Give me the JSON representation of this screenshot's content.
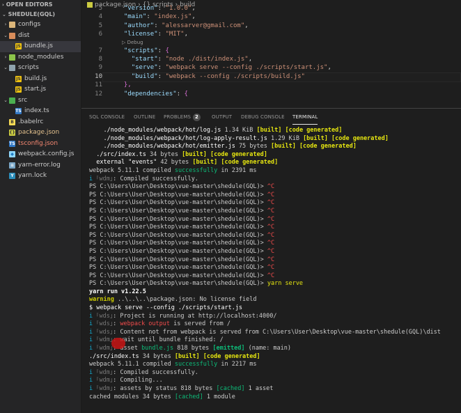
{
  "sidebar": {
    "open_editors": "OPEN EDITORS",
    "project": "SHEDULE(GQL)",
    "items": [
      {
        "label": "configs",
        "kind": "folder",
        "chev": "›",
        "icon": "folder",
        "depth": 0,
        "color": "#cccccc"
      },
      {
        "label": "dist",
        "kind": "folder",
        "chev": "⌄",
        "icon": "folder dist",
        "depth": 0,
        "color": "#cccccc"
      },
      {
        "label": "bundle.js",
        "kind": "file",
        "icon": "js",
        "glyph": "JS",
        "depth": 1,
        "color": "#cccccc",
        "active": true
      },
      {
        "label": "node_modules",
        "kind": "folder",
        "chev": "›",
        "icon": "folder node",
        "depth": 0,
        "color": "#cccccc"
      },
      {
        "label": "scripts",
        "kind": "folder",
        "chev": "⌄",
        "icon": "folder scripts",
        "depth": 0,
        "color": "#cccccc"
      },
      {
        "label": "build.js",
        "kind": "file",
        "icon": "js",
        "glyph": "JS",
        "depth": 1,
        "color": "#cccccc"
      },
      {
        "label": "start.js",
        "kind": "file",
        "icon": "js",
        "glyph": "JS",
        "depth": 1,
        "color": "#cccccc"
      },
      {
        "label": "src",
        "kind": "folder",
        "chev": "⌄",
        "icon": "folder src",
        "depth": 0,
        "color": "#cccccc"
      },
      {
        "label": "index.ts",
        "kind": "file",
        "icon": "ts",
        "glyph": "TS",
        "depth": 1,
        "color": "#cccccc"
      },
      {
        "label": ".babelrc",
        "kind": "file",
        "icon": "babel",
        "glyph": "B",
        "depth": 0,
        "color": "#cccccc"
      },
      {
        "label": "package.json",
        "kind": "file",
        "icon": "json",
        "glyph": "{}",
        "depth": 0,
        "color": "#e2c08d"
      },
      {
        "label": "tsconfig.json",
        "kind": "file",
        "icon": "ts",
        "glyph": "TS",
        "depth": 0,
        "color": "#f48771"
      },
      {
        "label": "webpack.config.js",
        "kind": "file",
        "icon": "wp",
        "glyph": "◆",
        "depth": 0,
        "color": "#cccccc"
      },
      {
        "label": "yarn-error.log",
        "kind": "file",
        "icon": "log",
        "glyph": "≡",
        "depth": 0,
        "color": "#cccccc"
      },
      {
        "label": "yarn.lock",
        "kind": "file",
        "icon": "lock",
        "glyph": "Y",
        "depth": 0,
        "color": "#cccccc"
      }
    ]
  },
  "breadcrumb": {
    "file": "package.json",
    "sep1": "›",
    "obj": "{} scripts",
    "sep2": "›",
    "leaf": "build"
  },
  "editor": {
    "lines": [
      {
        "n": "5",
        "segs": [
          [
            "  ",
            "pun"
          ],
          [
            "\"version\"",
            "key"
          ],
          [
            ": ",
            "pun"
          ],
          [
            "\"1.0.0\"",
            "str"
          ],
          [
            ",",
            "pun"
          ]
        ]
      },
      {
        "n": "4",
        "segs": [
          [
            "  ",
            "pun"
          ],
          [
            "\"main\"",
            "key"
          ],
          [
            ": ",
            "pun"
          ],
          [
            "\"index.js\"",
            "str"
          ],
          [
            ",",
            "pun"
          ]
        ]
      },
      {
        "n": "5",
        "segs": [
          [
            "  ",
            "pun"
          ],
          [
            "\"author\"",
            "key"
          ],
          [
            ": ",
            "pun"
          ],
          [
            "\"alessarver@gmail.com\"",
            "str"
          ],
          [
            ",",
            "pun"
          ]
        ]
      },
      {
        "n": "6",
        "segs": [
          [
            "  ",
            "pun"
          ],
          [
            "\"license\"",
            "key"
          ],
          [
            ": ",
            "pun"
          ],
          [
            "\"MIT\"",
            "str"
          ],
          [
            ",",
            "pun"
          ]
        ]
      },
      {
        "n": "7",
        "segs": [
          [
            "  ",
            "pun"
          ],
          [
            "\"scripts\"",
            "key"
          ],
          [
            ": ",
            "pun"
          ],
          [
            "{",
            "brk"
          ]
        ]
      },
      {
        "n": "8",
        "segs": [
          [
            "    ",
            "pun"
          ],
          [
            "\"start\"",
            "key"
          ],
          [
            ": ",
            "pun"
          ],
          [
            "\"node ./dist/index.js\"",
            "str"
          ],
          [
            ",",
            "pun"
          ]
        ]
      },
      {
        "n": "9",
        "segs": [
          [
            "    ",
            "pun"
          ],
          [
            "\"serve\"",
            "key"
          ],
          [
            ": ",
            "pun"
          ],
          [
            "\"webpack serve --config ./scripts/start.js\"",
            "str"
          ],
          [
            ",",
            "pun"
          ]
        ]
      },
      {
        "n": "10",
        "cur": true,
        "segs": [
          [
            "    ",
            "pun"
          ],
          [
            "\"build\"",
            "key"
          ],
          [
            ": ",
            "pun"
          ],
          [
            "\"webpack --config ./scripts/build.js\"",
            "str"
          ]
        ]
      },
      {
        "n": "11",
        "segs": [
          [
            "  ",
            "pun"
          ],
          [
            "},",
            "brk"
          ]
        ]
      },
      {
        "n": "12",
        "segs": [
          [
            "  ",
            "pun"
          ],
          [
            "\"dependencies\"",
            "key"
          ],
          [
            ": ",
            "pun"
          ],
          [
            "{",
            "brk"
          ]
        ]
      }
    ],
    "debug_hint": "▷ Debug"
  },
  "panel": {
    "tabs": [
      {
        "label": "SQL CONSOLE"
      },
      {
        "label": "OUTPUT",
        "pre": "OUTLINE"
      },
      {
        "label": "PROBLEMS",
        "badge": "2"
      },
      {
        "label": "OUTPUT"
      },
      {
        "label": "DEBUG CONSOLE"
      },
      {
        "label": "TERMINAL",
        "active": true
      }
    ],
    "tab_labels": [
      "SQL CONSOLE",
      "OUTLINE",
      "PROBLEMS",
      "OUTPUT",
      "DEBUG CONSOLE",
      "TERMINAL"
    ],
    "problems_count": "2"
  },
  "terminal": {
    "lines": [
      [
        [
          "    ./node_modules/webpack/hot/log.js ",
          "w"
        ],
        [
          "1.34 KiB ",
          "pl"
        ],
        [
          "[built] [code generated]",
          "y b"
        ]
      ],
      [
        [
          "    ./node_modules/webpack/hot/log-apply-result.js ",
          "w"
        ],
        [
          "1.29 KiB ",
          "pl"
        ],
        [
          "[built] [code generated]",
          "y b"
        ]
      ],
      [
        [
          "    ./node_modules/webpack/hot/emitter.js ",
          "w"
        ],
        [
          "75 bytes ",
          "pl"
        ],
        [
          "[built] [code generated]",
          "y b"
        ]
      ],
      [
        [
          "  ./src/index.ts ",
          "w"
        ],
        [
          "34 bytes ",
          "pl"
        ],
        [
          "[built] [code generated]",
          "y b"
        ]
      ],
      [
        [
          "  external \"events\" ",
          "w"
        ],
        [
          "42 bytes ",
          "pl"
        ],
        [
          "[built] [code generated]",
          "y b"
        ]
      ],
      [
        [
          "webpack 5.11.1 compiled ",
          "pl"
        ],
        [
          "successfully",
          "g"
        ],
        [
          " in 2391 ms",
          "pl"
        ]
      ],
      [
        [
          "i ",
          "c"
        ],
        [
          "｢wdm｣",
          "gr"
        ],
        [
          ": Compiled successfully.",
          "pl"
        ]
      ],
      [
        [
          "PS C:\\Users\\User\\Desktop\\vue-master\\shedule(GQL)> ",
          "pl"
        ],
        [
          "^C",
          "r"
        ]
      ],
      [
        [
          "PS C:\\Users\\User\\Desktop\\vue-master\\shedule(GQL)> ",
          "pl"
        ],
        [
          "^C",
          "r"
        ]
      ],
      [
        [
          "PS C:\\Users\\User\\Desktop\\vue-master\\shedule(GQL)> ",
          "pl"
        ],
        [
          "^C",
          "r"
        ]
      ],
      [
        [
          "PS C:\\Users\\User\\Desktop\\vue-master\\shedule(GQL)> ",
          "pl"
        ],
        [
          "^C",
          "r"
        ]
      ],
      [
        [
          "PS C:\\Users\\User\\Desktop\\vue-master\\shedule(GQL)> ",
          "pl"
        ],
        [
          "^C",
          "r"
        ]
      ],
      [
        [
          "PS C:\\Users\\User\\Desktop\\vue-master\\shedule(GQL)> ",
          "pl"
        ],
        [
          "^C",
          "r"
        ]
      ],
      [
        [
          "PS C:\\Users\\User\\Desktop\\vue-master\\shedule(GQL)> ",
          "pl"
        ],
        [
          "^C",
          "r"
        ]
      ],
      [
        [
          "PS C:\\Users\\User\\Desktop\\vue-master\\shedule(GQL)> ",
          "pl"
        ],
        [
          "^C",
          "r"
        ]
      ],
      [
        [
          "PS C:\\Users\\User\\Desktop\\vue-master\\shedule(GQL)> ",
          "pl"
        ],
        [
          "^C",
          "r"
        ]
      ],
      [
        [
          "PS C:\\Users\\User\\Desktop\\vue-master\\shedule(GQL)> ",
          "pl"
        ],
        [
          "^C",
          "r"
        ]
      ],
      [
        [
          "PS C:\\Users\\User\\Desktop\\vue-master\\shedule(GQL)> ",
          "pl"
        ],
        [
          "^C",
          "r"
        ]
      ],
      [
        [
          "PS C:\\Users\\User\\Desktop\\vue-master\\shedule(GQL)> ",
          "pl"
        ],
        [
          "^C",
          "r"
        ]
      ],
      [
        [
          "PS C:\\Users\\User\\Desktop\\vue-master\\shedule(GQL)> ",
          "pl"
        ],
        [
          "yarn serve",
          "y"
        ]
      ],
      [
        [
          "yarn run v1.22.5",
          "w b"
        ]
      ],
      [
        [
          "warning",
          "dy b"
        ],
        [
          " ..\\..\\..\\package.json: No license field",
          "pl"
        ]
      ],
      [
        [
          "$ webpack serve --config ./scripts/start.js",
          "w"
        ]
      ],
      [
        [
          "i ",
          "c"
        ],
        [
          "｢wds｣",
          "gr"
        ],
        [
          ": Project is running at http://localhost:4000/",
          "pl"
        ]
      ],
      [
        [
          "i ",
          "c"
        ],
        [
          "｢wds｣",
          "gr"
        ],
        [
          ": ",
          "pl"
        ],
        [
          "webpack output",
          "r"
        ],
        [
          " is served from /",
          "pl"
        ]
      ],
      [
        [
          "i ",
          "c"
        ],
        [
          "｢wds｣",
          "gr"
        ],
        [
          ": Content not from webpack is served from C:\\Users\\User\\Desktop\\vue-master\\shedule(GQL)\\dist",
          "pl"
        ]
      ],
      [
        [
          "i ",
          "c"
        ],
        [
          "｢wdm｣",
          "gr"
        ],
        [
          ": wait until bundle finished: /",
          "pl"
        ]
      ],
      [
        [
          "i ",
          "c"
        ],
        [
          "｢wdm｣",
          "gr"
        ],
        [
          ": asset ",
          "pl"
        ],
        [
          "bundle.js",
          "g"
        ],
        [
          " 818 bytes ",
          "pl"
        ],
        [
          "[emitted]",
          "g b"
        ],
        [
          " (name: main)",
          "pl"
        ]
      ],
      [
        [
          "./src/index.ts ",
          "w"
        ],
        [
          "34 bytes ",
          "pl"
        ],
        [
          "[built] [code generated]",
          "y b"
        ]
      ],
      [
        [
          "webpack 5.11.1 compiled ",
          "pl"
        ],
        [
          "successfully",
          "g"
        ],
        [
          " in 2217 ms",
          "pl"
        ]
      ],
      [
        [
          "i ",
          "c"
        ],
        [
          "｢wdm｣",
          "gr"
        ],
        [
          ": Compiled successfully.",
          "pl"
        ]
      ],
      [
        [
          "i ",
          "c"
        ],
        [
          "｢wdm｣",
          "gr"
        ],
        [
          ": Compiling...",
          "pl"
        ]
      ],
      [
        [
          "i ",
          "c"
        ],
        [
          "｢wdm｣",
          "gr"
        ],
        [
          ": assets by status 818 bytes ",
          "pl"
        ],
        [
          "[cached]",
          "g"
        ],
        [
          " 1 asset",
          "pl"
        ]
      ],
      [
        [
          "cached modules 34 bytes ",
          "pl"
        ],
        [
          "[cached]",
          "g"
        ],
        [
          " 1 module",
          "pl"
        ]
      ]
    ]
  }
}
